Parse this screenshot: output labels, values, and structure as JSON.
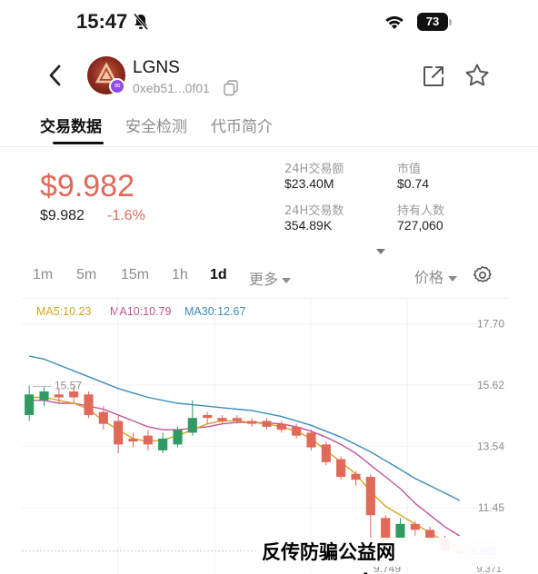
{
  "status_bar": {
    "time": "15:47",
    "battery": "73"
  },
  "token": {
    "name": "LGNS",
    "address": "0xeb51...0f01"
  },
  "tabs": [
    {
      "label": "交易数据",
      "active": true
    },
    {
      "label": "安全检测",
      "active": false
    },
    {
      "label": "代币简介",
      "active": false
    }
  ],
  "price": {
    "main": "$9.982",
    "sub": "$9.982",
    "change": "-1.6%"
  },
  "stats": {
    "volume_24h": {
      "label": "24H交易额",
      "value": "$23.40M"
    },
    "market_cap": {
      "label": "市值",
      "value": "$0.74"
    },
    "txns_24h": {
      "label": "24H交易数",
      "value": "354.89K"
    },
    "holders": {
      "label": "持有人数",
      "value": "727,060"
    }
  },
  "intervals": [
    "1m",
    "5m",
    "15m",
    "1h",
    "1d",
    "更多"
  ],
  "active_interval": "1d",
  "price_type": "价格",
  "ma_legend": {
    "ma5": "MA5:10.23",
    "ma10": "MA10:10.79",
    "ma30": "MA30:12.67"
  },
  "colors": {
    "up": "#2f9b63",
    "down": "#e0695a",
    "ma5": "#d6a520",
    "ma10": "#c0559b",
    "ma30": "#3a8dbb"
  },
  "watermark": "反传防骗公益网 www.wazi.cc",
  "chart_data": {
    "type": "candlestick",
    "y_ticks": [
      "17.70",
      "15.62",
      "13.54",
      "11.45"
    ],
    "ylim": [
      9.2,
      17.9
    ],
    "high_label": "15.57",
    "low_label": "9.749",
    "current_tag": "9.982",
    "bottom_tick": "9.371",
    "candles": [
      {
        "o": 14.6,
        "c": 15.3,
        "h": 15.6,
        "l": 14.4
      },
      {
        "o": 15.1,
        "c": 15.4,
        "h": 15.55,
        "l": 14.9
      },
      {
        "o": 15.3,
        "c": 15.2,
        "h": 15.5,
        "l": 15.0
      },
      {
        "o": 15.4,
        "c": 15.2,
        "h": 15.57,
        "l": 15.0
      },
      {
        "o": 15.3,
        "c": 14.6,
        "h": 15.4,
        "l": 14.5
      },
      {
        "o": 14.7,
        "c": 14.3,
        "h": 14.9,
        "l": 14.1
      },
      {
        "o": 14.4,
        "c": 13.6,
        "h": 14.6,
        "l": 13.3
      },
      {
        "o": 13.8,
        "c": 13.7,
        "h": 14.0,
        "l": 13.5
      },
      {
        "o": 13.9,
        "c": 13.6,
        "h": 14.1,
        "l": 13.4
      },
      {
        "o": 13.4,
        "c": 13.8,
        "h": 14.0,
        "l": 13.3
      },
      {
        "o": 13.6,
        "c": 14.1,
        "h": 14.2,
        "l": 13.5
      },
      {
        "o": 14.0,
        "c": 14.5,
        "h": 15.1,
        "l": 13.9
      },
      {
        "o": 14.6,
        "c": 14.5,
        "h": 14.7,
        "l": 14.3
      },
      {
        "o": 14.5,
        "c": 14.4,
        "h": 14.6,
        "l": 14.3
      },
      {
        "o": 14.5,
        "c": 14.4,
        "h": 14.6,
        "l": 14.3
      },
      {
        "o": 14.4,
        "c": 14.3,
        "h": 14.5,
        "l": 14.2
      },
      {
        "o": 14.4,
        "c": 14.2,
        "h": 14.5,
        "l": 14.1
      },
      {
        "o": 14.3,
        "c": 14.1,
        "h": 14.4,
        "l": 14.0
      },
      {
        "o": 14.2,
        "c": 13.9,
        "h": 14.3,
        "l": 13.8
      },
      {
        "o": 14.0,
        "c": 13.5,
        "h": 14.1,
        "l": 13.4
      },
      {
        "o": 13.6,
        "c": 13.0,
        "h": 13.7,
        "l": 12.9
      },
      {
        "o": 13.1,
        "c": 12.5,
        "h": 13.2,
        "l": 12.4
      },
      {
        "o": 12.6,
        "c": 12.4,
        "h": 12.7,
        "l": 12.2
      },
      {
        "o": 12.5,
        "c": 11.2,
        "h": 12.6,
        "l": 10.3
      },
      {
        "o": 11.1,
        "c": 10.3,
        "h": 11.2,
        "l": 10.1
      },
      {
        "o": 10.4,
        "c": 10.9,
        "h": 11.1,
        "l": 10.3
      },
      {
        "o": 10.9,
        "c": 10.7,
        "h": 11.0,
        "l": 10.5
      },
      {
        "o": 10.7,
        "c": 10.4,
        "h": 10.8,
        "l": 10.2
      },
      {
        "o": 10.4,
        "c": 10.0,
        "h": 10.5,
        "l": 9.9
      },
      {
        "o": 10.0,
        "c": 9.9,
        "h": 10.1,
        "l": 9.749
      }
    ],
    "ma5": [
      15.2,
      15.2,
      15.1,
      15.0,
      14.8,
      14.4,
      14.1,
      13.8,
      13.7,
      13.75,
      13.9,
      14.1,
      14.3,
      14.4,
      14.4,
      14.35,
      14.3,
      14.2,
      14.05,
      13.8,
      13.4,
      13.0,
      12.6,
      12.0,
      11.5,
      11.2,
      10.9,
      10.6,
      10.3,
      10.1
    ],
    "ma10": [
      15.1,
      15.1,
      15.0,
      15.0,
      14.9,
      14.8,
      14.6,
      14.4,
      14.2,
      14.1,
      14.1,
      14.15,
      14.2,
      14.3,
      14.35,
      14.35,
      14.33,
      14.3,
      14.2,
      14.05,
      13.85,
      13.6,
      13.3,
      12.9,
      12.5,
      12.1,
      11.6,
      11.2,
      10.8,
      10.5
    ],
    "ma30": [
      16.6,
      16.5,
      16.3,
      16.1,
      15.9,
      15.7,
      15.5,
      15.35,
      15.2,
      15.1,
      15.0,
      14.95,
      14.9,
      14.85,
      14.8,
      14.75,
      14.65,
      14.55,
      14.4,
      14.25,
      14.05,
      13.85,
      13.6,
      13.35,
      13.05,
      12.75,
      12.45,
      12.2,
      11.95,
      11.7
    ]
  }
}
